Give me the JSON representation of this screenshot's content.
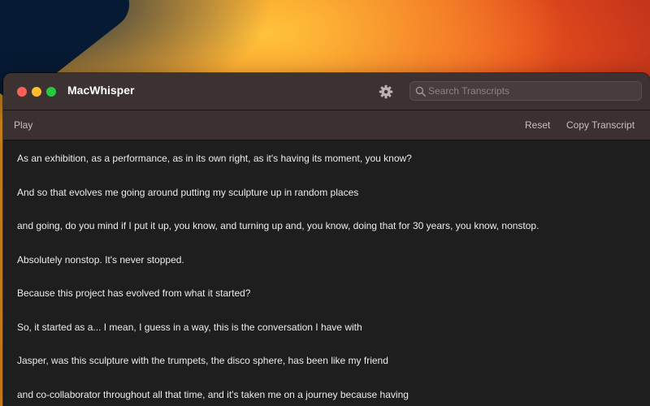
{
  "window": {
    "title": "MacWhisper"
  },
  "header": {
    "search_placeholder": "Search Transcripts"
  },
  "toolbar": {
    "play_label": "Play",
    "reset_label": "Reset",
    "copy_label": "Copy Transcript"
  },
  "transcript": {
    "lines": [
      "As an exhibition, as a performance, as in its own right, as it's having its moment, you know?",
      "And so that evolves me going around putting my sculpture up in random places",
      "and going, do you mind if I put it up, you know, and turning up and, you know, doing that for 30 years, you know, nonstop.",
      "Absolutely nonstop. It's never stopped.",
      "Because this project has evolved from what it started?",
      "So, it started as a... I mean, I guess in a way, this is the conversation I have with",
      "Jasper, was this sculpture with the trumpets, the disco sphere, has been like my friend",
      "and co-collaborator throughout all that time, and it's taken me on a journey because having"
    ]
  },
  "icons": {
    "settings": "gear-icon",
    "search": "search-icon"
  },
  "colors": {
    "close": "#fe5f57",
    "minimize": "#febc2e",
    "maximize": "#28c840",
    "titlebar": "#3d3232",
    "content": "#1e1e1e"
  }
}
